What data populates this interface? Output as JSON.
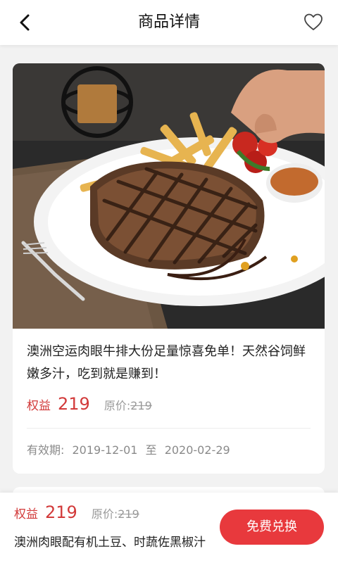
{
  "header": {
    "title": "商品详情",
    "back_icon": "chevron-left-icon",
    "favorite_icon": "heart-outline-icon"
  },
  "product": {
    "description": "澳洲空运肉眼牛排大份足量惊喜免单！天然谷饲鲜嫩多汁，吃到就是赚到！",
    "quan_label": "权益",
    "quan_value": "219",
    "original_label": "原价:",
    "original_value": "219",
    "validity_label": "有效期:",
    "validity_start": "2019-12-01",
    "validity_to": "至",
    "validity_end": "2020-02-29"
  },
  "bottom_bar": {
    "quan_label": "权益",
    "quan_value": "219",
    "original_label": "原价:",
    "original_value": "219",
    "product_name": "澳洲肉眼配有机土豆、时蔬佐黑椒汁",
    "redeem_label": "免费兑换"
  },
  "colors": {
    "accent": "#e8393d",
    "price": "#d23a3a",
    "muted": "#999999"
  }
}
